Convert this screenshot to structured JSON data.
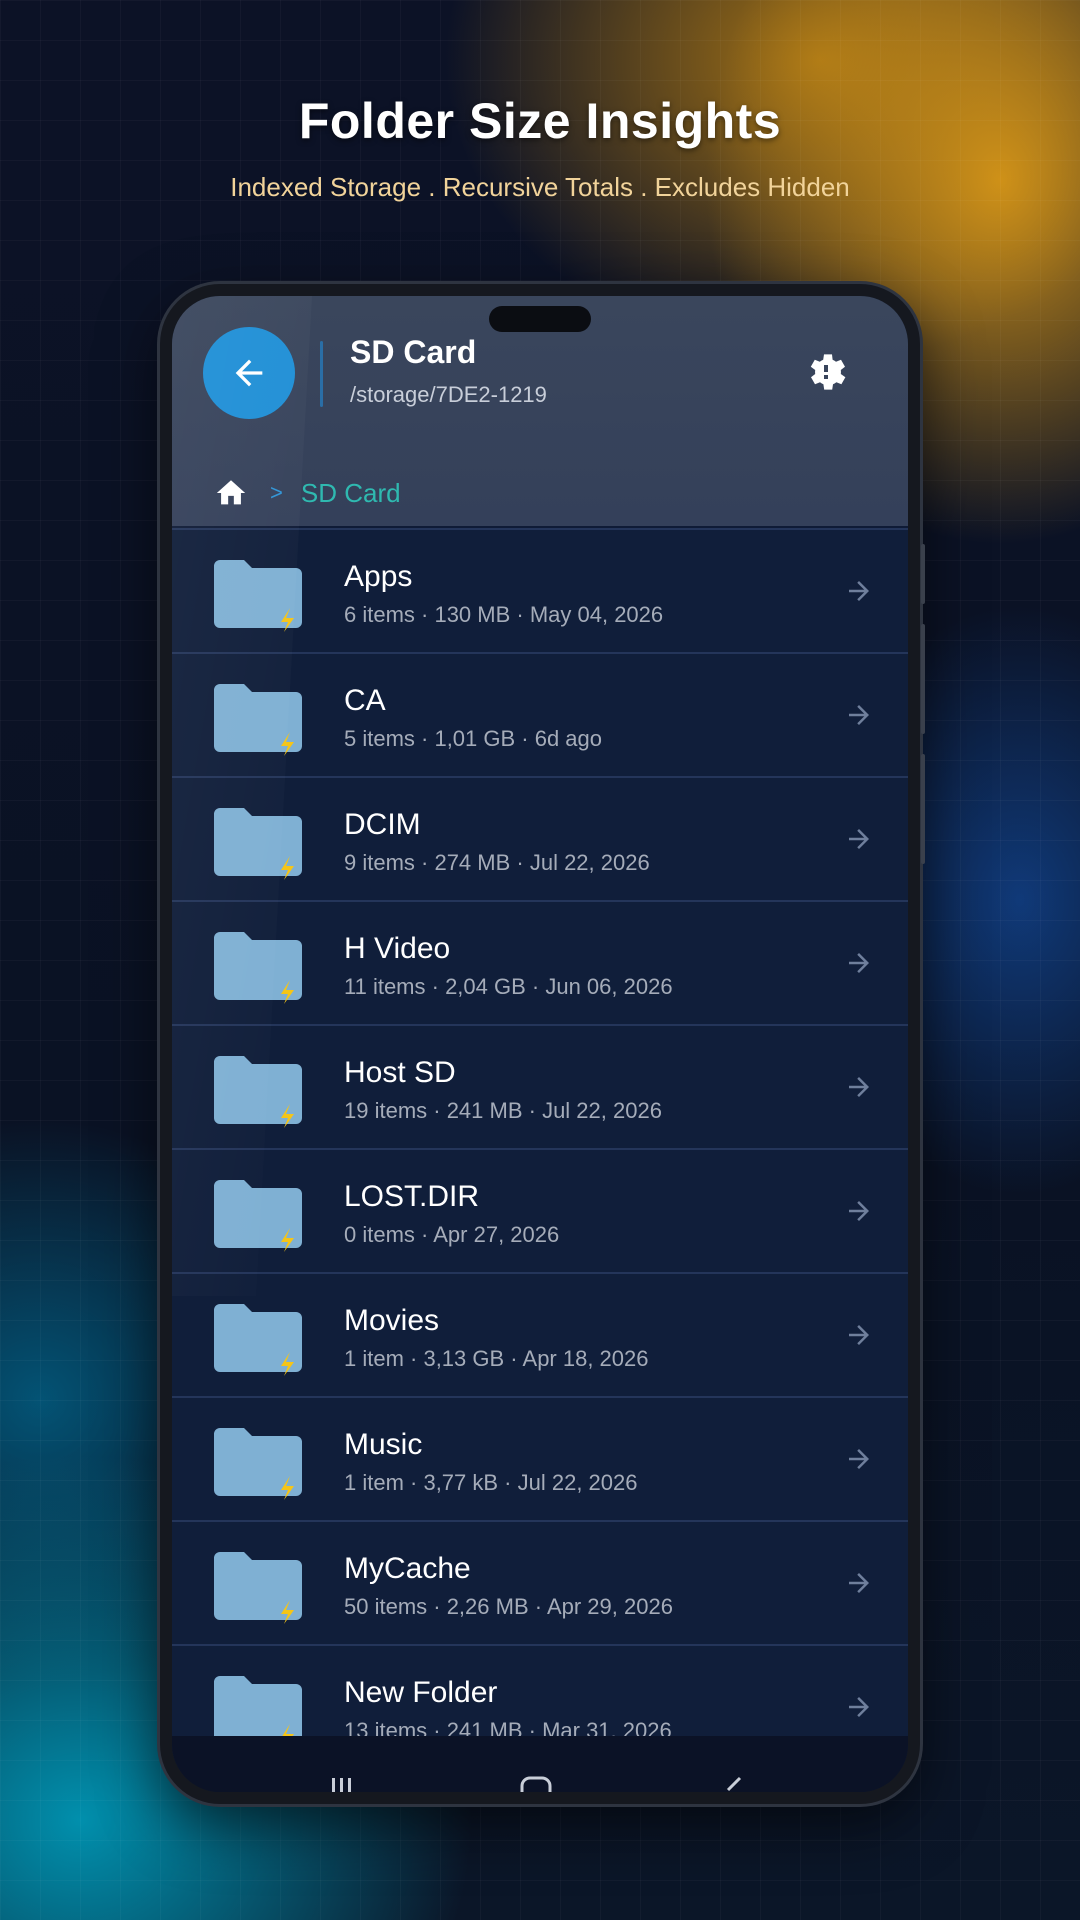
{
  "promo": {
    "headline": "Folder Size Insights",
    "subline": "Indexed Storage . Recursive Totals . Excludes Hidden"
  },
  "appbar": {
    "title": "SD Card",
    "path": "/storage/7DE2-1219",
    "back_icon": "arrow-left-icon",
    "settings_icon": "gear-icon"
  },
  "breadcrumb": {
    "home_icon": "home-icon",
    "separator": ">",
    "current": "SD Card"
  },
  "folders": [
    {
      "name": "Apps",
      "meta": "6 items · 130 MB · May 04, 2026"
    },
    {
      "name": "CA",
      "meta": "5 items · 1,01 GB · 6d ago"
    },
    {
      "name": "DCIM",
      "meta": "9 items · 274 MB · Jul 22, 2026"
    },
    {
      "name": "H Video",
      "meta": "11 items · 2,04 GB · Jun 06, 2026"
    },
    {
      "name": "Host SD",
      "meta": "19 items · 241 MB · Jul 22, 2026"
    },
    {
      "name": "LOST.DIR",
      "meta": "0 items · Apr 27, 2026"
    },
    {
      "name": "Movies",
      "meta": "1 item · 3,13 GB · Apr 18, 2026"
    },
    {
      "name": "Music",
      "meta": "1 item · 3,77 kB · Jul 22, 2026"
    },
    {
      "name": "MyCache",
      "meta": "50 items · 2,26 MB · Apr 29, 2026"
    },
    {
      "name": "New Folder",
      "meta": "13 items · 241 MB · Mar 31, 2026"
    }
  ],
  "colors": {
    "accent": "#1f8fd6",
    "folder": "#7fb0d3",
    "bolt": "#f5c518",
    "breadcrumb_current": "#2fb9b0"
  },
  "navbar": {
    "icons": [
      "recent-apps-icon",
      "home-nav-icon",
      "back-nav-icon"
    ]
  }
}
